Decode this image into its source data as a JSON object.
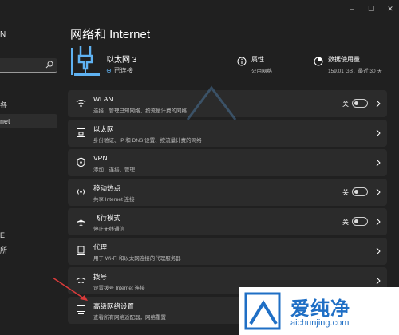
{
  "window": {
    "minimize": "–",
    "maximize": "☐",
    "close": "✕"
  },
  "sidebar": {
    "user_name": "N",
    "items": [
      {
        "label": "各",
        "active": false
      },
      {
        "label": "net",
        "active": true
      },
      {
        "label": "E",
        "active": false
      },
      {
        "label": "所",
        "active": false
      }
    ]
  },
  "page_title": "网络和 Internet",
  "hero": {
    "name": "以太网 3",
    "status": "已连接",
    "properties": {
      "label": "属性",
      "sub": "公用网络"
    },
    "data_usage": {
      "label": "数据使用量",
      "sub": "159.01 GB，最近 30 天"
    }
  },
  "rows": [
    {
      "key": "wlan",
      "title": "WLAN",
      "subtitle": "连接、管理已知网络、按流量计费的网络",
      "toggle": "关",
      "icon": "wifi-icon"
    },
    {
      "key": "ethernet",
      "title": "以太网",
      "subtitle": "身份验证、IP 和 DNS 设置、按流量计费的网络",
      "toggle": null,
      "icon": "ethernet-icon"
    },
    {
      "key": "vpn",
      "title": "VPN",
      "subtitle": "添加、连接、管理",
      "toggle": null,
      "icon": "vpn-shield-icon"
    },
    {
      "key": "hotspot",
      "title": "移动热点",
      "subtitle": "共享 Internet 连接",
      "toggle": "关",
      "icon": "hotspot-icon"
    },
    {
      "key": "airplane",
      "title": "飞行模式",
      "subtitle": "停止无线通信",
      "toggle": "关",
      "icon": "airplane-icon"
    },
    {
      "key": "proxy",
      "title": "代理",
      "subtitle": "用于 Wi-Fi 和以太网连接的代理服务器",
      "toggle": null,
      "icon": "proxy-icon"
    },
    {
      "key": "dialup",
      "title": "拨号",
      "subtitle": "设置拨号 Internet 连接",
      "toggle": null,
      "icon": "dialup-icon"
    },
    {
      "key": "advanced",
      "title": "高级网络设置",
      "subtitle": "查看所有网络适配器，网络重置",
      "toggle": null,
      "icon": "advanced-network-icon"
    }
  ],
  "watermark": {
    "cn": "爱纯净",
    "url": "aichunjing.com"
  },
  "colors": {
    "accent": "#5fb2f2",
    "watermark": "#1f6fc5"
  }
}
